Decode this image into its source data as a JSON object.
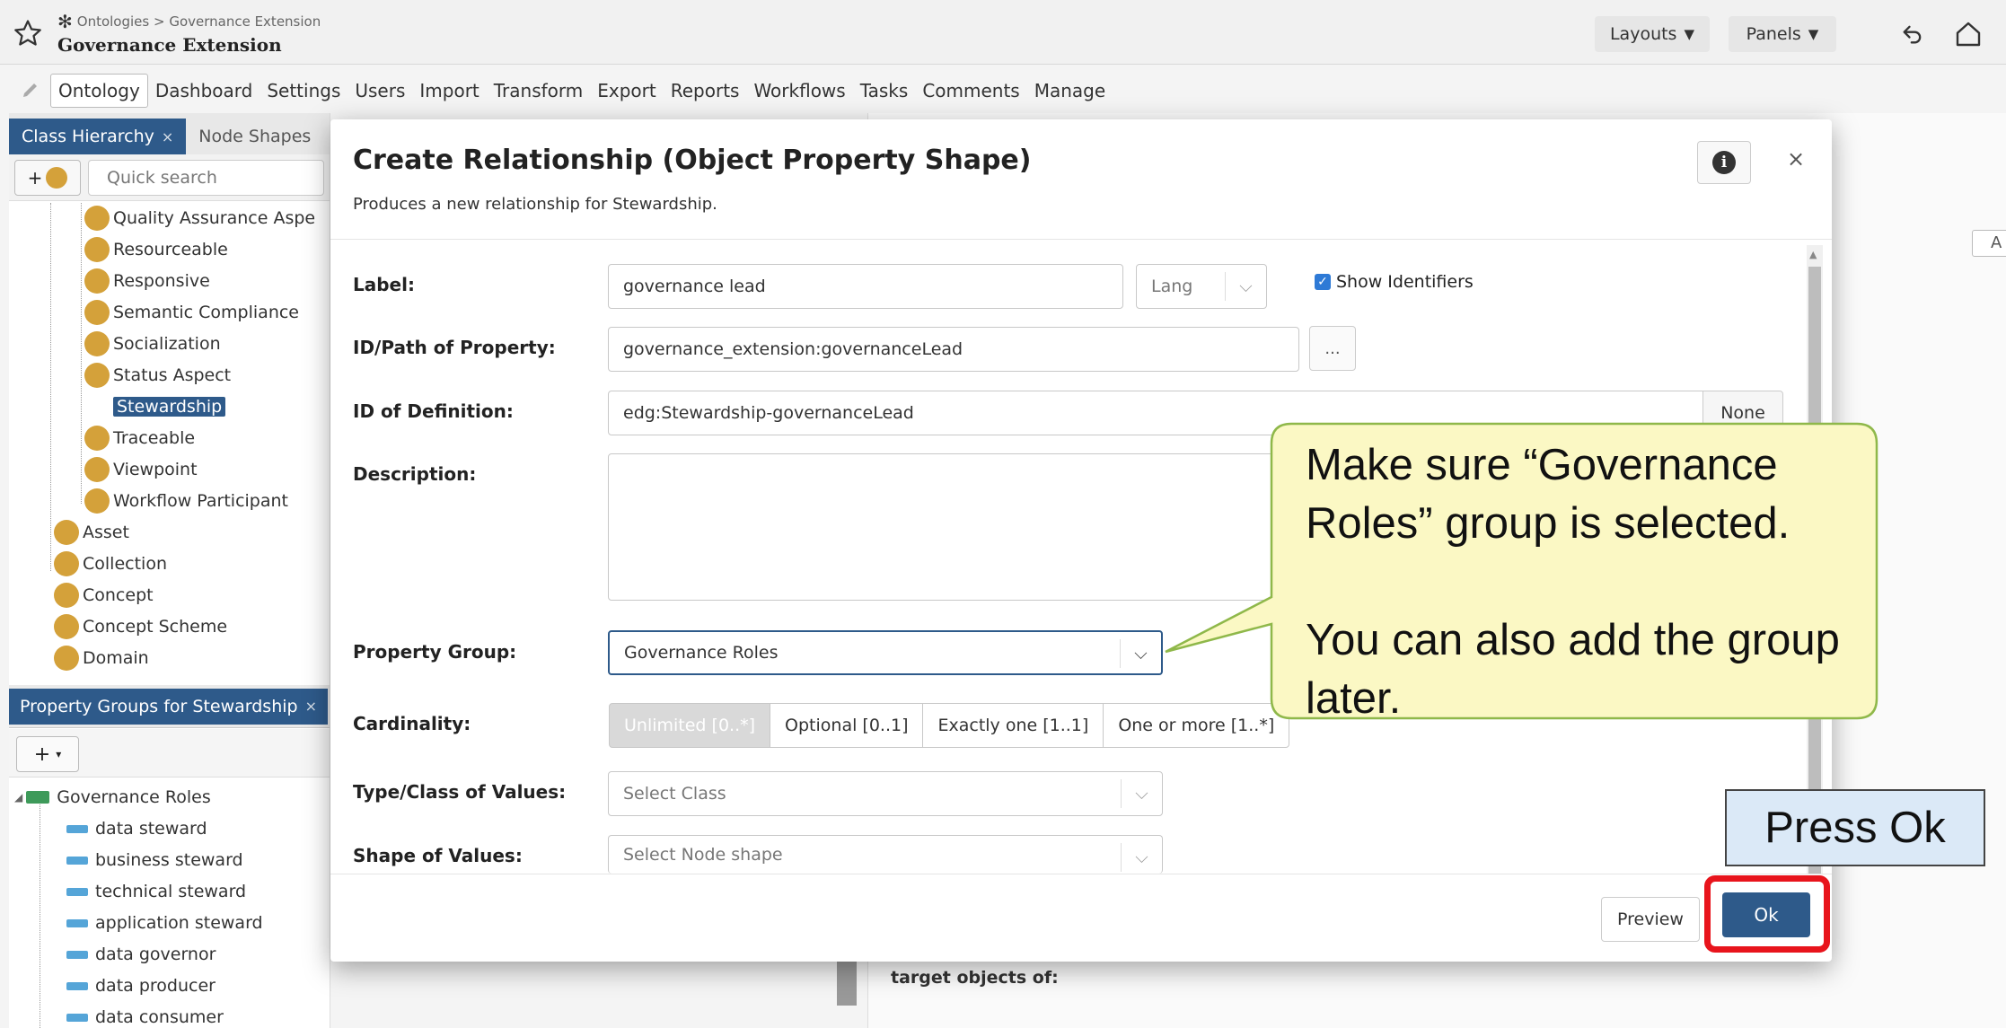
{
  "header": {
    "breadcrumb": "Ontologies > Governance Extension",
    "title": "Governance Extension",
    "layouts_label": "Layouts",
    "panels_label": "Panels"
  },
  "menu": [
    "Ontology",
    "Dashboard",
    "Settings",
    "Users",
    "Import",
    "Transform",
    "Export",
    "Reports",
    "Workflows",
    "Tasks",
    "Comments",
    "Manage"
  ],
  "left_panel": {
    "tabs": [
      "Class Hierarchy",
      "Node Shapes"
    ],
    "search_placeholder": "Quick search",
    "tree": [
      {
        "label": "Quality Assurance Aspe"
      },
      {
        "label": "Resourceable"
      },
      {
        "label": "Responsive"
      },
      {
        "label": "Semantic Compliance"
      },
      {
        "label": "Socialization"
      },
      {
        "label": "Status Aspect"
      },
      {
        "label": "Stewardship"
      },
      {
        "label": "Traceable"
      },
      {
        "label": "Viewpoint"
      },
      {
        "label": "Workflow Participant"
      },
      {
        "label": "Asset"
      },
      {
        "label": "Collection"
      },
      {
        "label": "Concept"
      },
      {
        "label": "Concept Scheme"
      },
      {
        "label": "Domain"
      }
    ],
    "property_groups_tab": "Property Groups for Stewardship",
    "add_label": "+",
    "group_tree": {
      "group": "Governance Roles",
      "items": [
        "data steward",
        "business steward",
        "technical steward",
        "application steward",
        "data governor",
        "data producer",
        "data consumer"
      ]
    }
  },
  "background": {
    "target_label": "target objects of:",
    "right_edge_button": "A"
  },
  "modal": {
    "title": "Create Relationship (Object Property Shape)",
    "subtitle": "Produces a new relationship for Stewardship.",
    "close": "×",
    "label_label": "Label:",
    "label_value": "governance lead",
    "lang_placeholder": "Lang",
    "show_identifiers": "Show Identifiers",
    "id_path_label": "ID/Path of Property:",
    "id_path_value": "governance_extension:governanceLead",
    "dots_button": "...",
    "definition_label": "ID of Definition:",
    "definition_value": "edg:Stewardship-governanceLead",
    "none_button": "None",
    "description_label": "Description:",
    "property_group_label": "Property Group:",
    "property_group_value": "Governance Roles",
    "cardinality_label": "Cardinality:",
    "cardinality_options": [
      "Unlimited [0..*]",
      "Optional [0..1]",
      "Exactly one [1..1]",
      "One or more [1..*]"
    ],
    "type_label": "Type/Class of Values:",
    "type_placeholder": "Select Class",
    "shape_label": "Shape of Values:",
    "shape_placeholder": "Select Node shape",
    "preview_button": "Preview",
    "ok_button": "Ok"
  },
  "annotations": {
    "callout_line1": "Make sure “Governance Roles” group is selected.",
    "callout_line2": "You can also add the group later.",
    "press_ok": "Press Ok"
  },
  "colors": {
    "accent": "#2e5a8a",
    "class_dot": "#d4a13a",
    "highlight_outline": "#e8141c",
    "callout_fill": "#fbf8c4",
    "callout_border": "#8fb84a",
    "press_fill": "#dbe9f7"
  }
}
